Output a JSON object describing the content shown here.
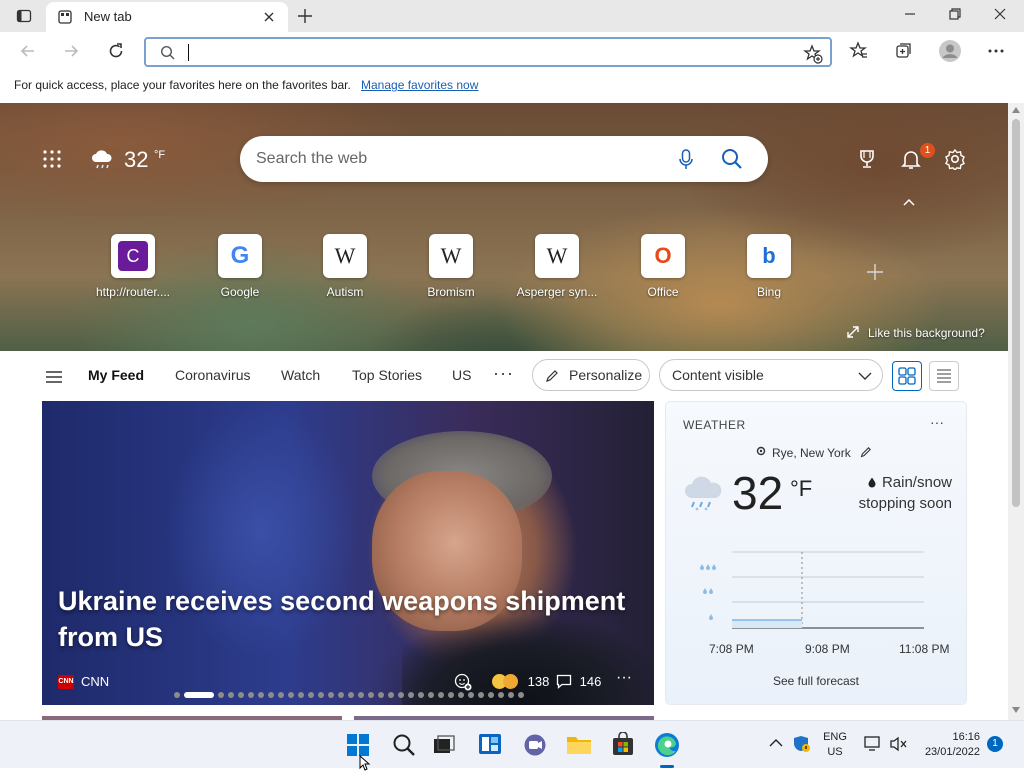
{
  "browser": {
    "tab_title": "New tab",
    "favorites_bar_text": "For quick access, place your favorites here on the favorites bar.",
    "favorites_bar_link": "Manage favorites now",
    "address_value": ""
  },
  "hero": {
    "weather_temp": "32",
    "weather_unit": "°F",
    "search_placeholder": "Search the web",
    "notification_count": "1",
    "like_background": "Like this background?",
    "quick_links": [
      {
        "label": "http://router....",
        "icon": "C",
        "color": "#6a1b9a"
      },
      {
        "label": "Google",
        "icon": "G",
        "color": "#4285f4"
      },
      {
        "label": "Autism",
        "icon": "W",
        "color": "#222222"
      },
      {
        "label": "Bromism",
        "icon": "W",
        "color": "#222222"
      },
      {
        "label": "Asperger syn...",
        "icon": "W",
        "color": "#222222"
      },
      {
        "label": "Office",
        "icon": "O",
        "color": "#e64a19"
      },
      {
        "label": "Bing",
        "icon": "b",
        "color": "#1e6fd9"
      }
    ]
  },
  "feed": {
    "nav": [
      "My Feed",
      "Coronavirus",
      "Watch",
      "Top Stories",
      "US"
    ],
    "personalize": "Personalize",
    "content_visible": "Content visible"
  },
  "news": {
    "headline": "Ukraine receives second weapons shipment from US",
    "source": "CNN",
    "reactions": "138",
    "comments": "146"
  },
  "weather_card": {
    "title": "WEATHER",
    "location": "Rye, New York",
    "temp": "32",
    "unit": "°F",
    "condition": "Rain/snow stopping soon",
    "times": [
      "7:08 PM",
      "9:08 PM",
      "11:08 PM"
    ],
    "full_forecast": "See full forecast"
  },
  "taskbar": {
    "lang": "ENG",
    "region": "US",
    "time": "16:16",
    "date": "23/01/2022",
    "notifications": "1"
  },
  "colors": {
    "accent": "#0067c0",
    "badge": "#e0501a"
  }
}
